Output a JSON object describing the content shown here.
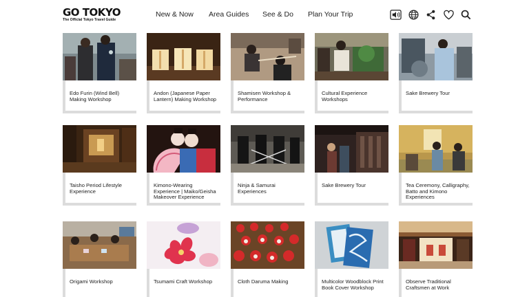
{
  "logo": {
    "main": "GO TOKYO",
    "sub": "The Official Tokyo Travel Guide"
  },
  "nav": [
    "New & Now",
    "Area Guides",
    "See & Do",
    "Plan Your Trip"
  ],
  "icons": [
    "speaker-icon",
    "globe-icon",
    "share-icon",
    "heart-icon",
    "search-icon"
  ],
  "cards": [
    {
      "title": "Edo Furin (Wind Bell) Making Workshop"
    },
    {
      "title": "Andon (Japanese Paper Lantern) Making Workshop"
    },
    {
      "title": "Shamisen Workshop & Performance"
    },
    {
      "title": "Cultural Experience Workshops"
    },
    {
      "title": "Sake Brewery Tour"
    },
    {
      "title": "Taisho Period Lifestyle Experience"
    },
    {
      "title": "Kimono-Wearing Experience | Maiko/Geisha Makeover Experience"
    },
    {
      "title": "Ninja & Samurai Experiences"
    },
    {
      "title": "Sake Brewery Tour"
    },
    {
      "title": "Tea Ceremony, Calligraphy, Batto and Kimono Experiences"
    },
    {
      "title": "Origami Workshop"
    },
    {
      "title": "Tsumami Craft Workshop"
    },
    {
      "title": "Cloth Daruma Making"
    },
    {
      "title": "Multicolor Woodblock Print Book Cover Workshop"
    },
    {
      "title": "Observe Traditional Craftsmen at Work"
    }
  ]
}
